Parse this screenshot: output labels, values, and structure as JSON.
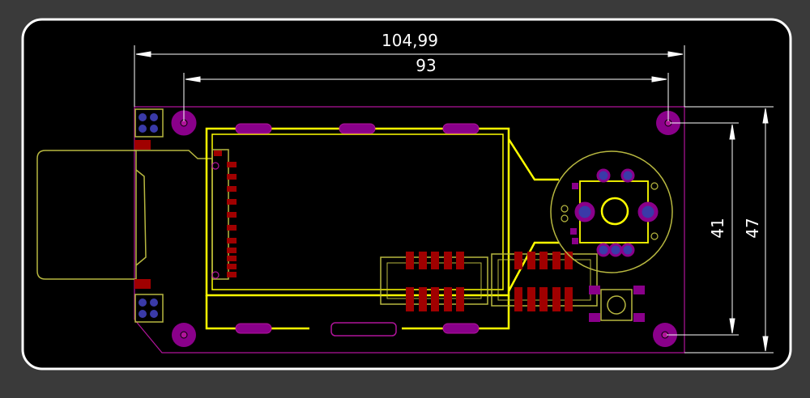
{
  "colors": {
    "background": "#3a3a3a",
    "panel": "#000000",
    "panel_border": "#ffffff",
    "outline": "#b0149a",
    "silkscreen": "#ffff00",
    "courtyard": "#b8b840",
    "pad_red": "#a00000",
    "pad_purple": "#8a008a",
    "pad_blue": "#3a3aa8",
    "dimension": "#ffffff"
  },
  "dimensions": {
    "overall_width": "104,99",
    "hole_spacing_horizontal": "93",
    "hole_spacing_vertical": "41",
    "overall_height": "47"
  }
}
